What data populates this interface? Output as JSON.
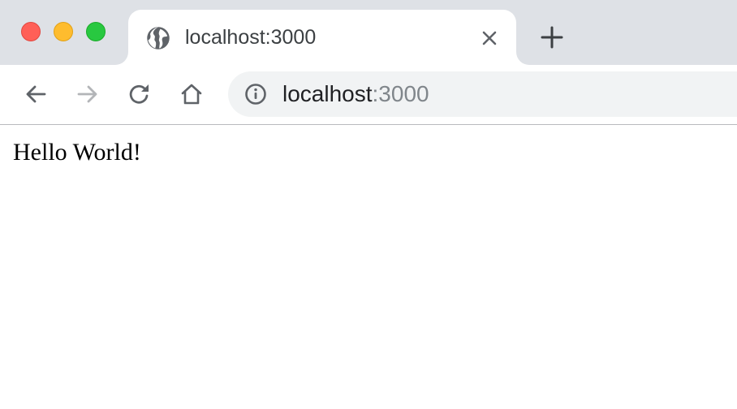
{
  "colors": {
    "tabstrip_bg": "#dee1e6",
    "omnibox_bg": "#f1f3f4",
    "traffic_close": "#ff5f57",
    "traffic_minimize": "#febc2e",
    "traffic_maximize": "#28c840",
    "icon_active": "#5f6368",
    "icon_disabled": "#b3b5b8",
    "url_port_color": "#80868b"
  },
  "window_controls": {
    "close_icon": "red-circle",
    "minimize_icon": "yellow-circle",
    "maximize_icon": "green-circle"
  },
  "tabs": [
    {
      "title": "localhost:3000",
      "favicon": "globe-icon",
      "close_icon": "close-icon",
      "active": true
    }
  ],
  "new_tab_icon": "plus-icon",
  "toolbar": {
    "back_icon": "arrow-left-icon",
    "forward_icon": "arrow-right-icon",
    "forward_enabled": false,
    "reload_icon": "reload-icon",
    "home_icon": "home-icon"
  },
  "omnibox": {
    "info_icon": "info-icon",
    "url_host": "localhost",
    "url_port": ":3000"
  },
  "page": {
    "text": "Hello World!"
  }
}
